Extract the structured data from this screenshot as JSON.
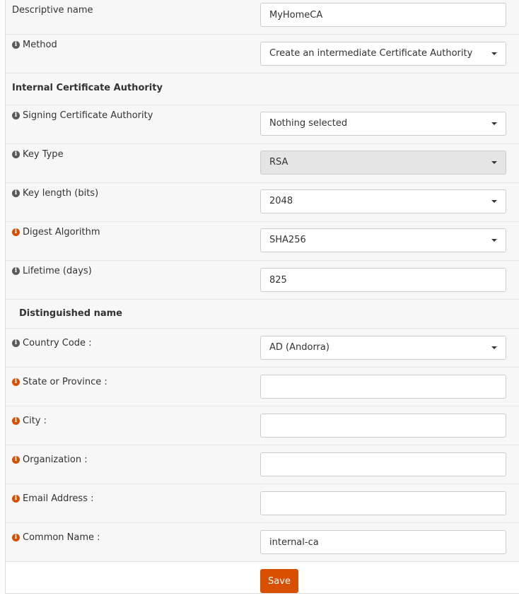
{
  "fields": {
    "descriptive_name": {
      "label": "Descriptive name",
      "value": "MyHomeCA"
    },
    "method": {
      "label": "Method",
      "value": "Create an intermediate Certificate Authority"
    },
    "internal_ca_section": "Internal Certificate Authority",
    "signing_ca": {
      "label": "Signing Certificate Authority",
      "value": "Nothing selected"
    },
    "key_type": {
      "label": "Key Type",
      "value": "RSA"
    },
    "key_length": {
      "label": "Key length (bits)",
      "value": "2048"
    },
    "digest_algorithm": {
      "label": "Digest Algorithm",
      "value": "SHA256"
    },
    "lifetime": {
      "label": "Lifetime (days)",
      "value": "825"
    },
    "distinguished_section": "Distinguished name",
    "country_code": {
      "label": "Country Code :",
      "value": "AD (Andorra)"
    },
    "state": {
      "label": "State or Province :",
      "value": ""
    },
    "city": {
      "label": "City :",
      "value": ""
    },
    "organization": {
      "label": "Organization :",
      "value": ""
    },
    "email": {
      "label": "Email Address :",
      "value": ""
    },
    "common_name": {
      "label": "Common Name :",
      "value": "internal-ca"
    }
  },
  "actions": {
    "save_label": "Save"
  },
  "colors": {
    "accent": "#d94f00",
    "info_icon": "#5a5a5a",
    "required_info_icon": "#d94f00",
    "disabled_bg": "#e5e5e5",
    "alt_row_bg": "#f7f7f7"
  }
}
